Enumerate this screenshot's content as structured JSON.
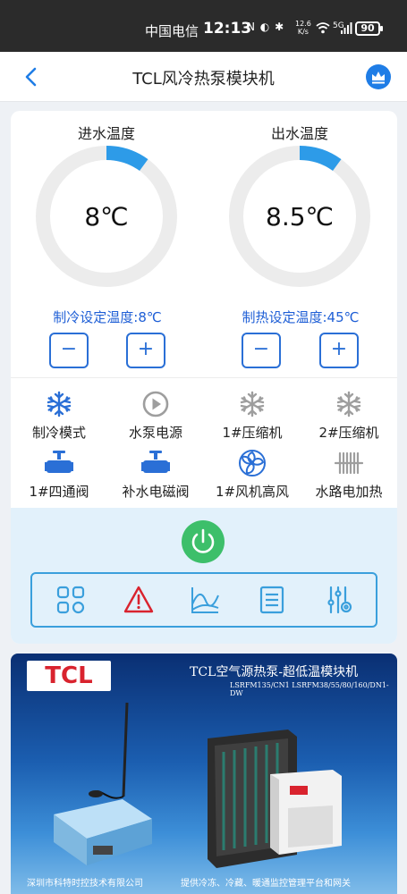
{
  "status_bar": {
    "carrier": "中国电信",
    "time": "12:13",
    "icons": "N ◐ ✱",
    "speed_value": "12.6",
    "speed_unit": "K/s",
    "network": "5G",
    "battery": "90"
  },
  "header": {
    "title": "TCL风冷热泵模块机",
    "back_icon": "chevron-left-icon",
    "crown_icon": "crown-icon"
  },
  "gauges": [
    {
      "label": "进水温度",
      "value": "8℃",
      "level": 0.1
    },
    {
      "label": "出水温度",
      "value": "8.5℃",
      "level": 0.1
    }
  ],
  "setpoints": {
    "cooling": "制冷设定温度:8℃",
    "heating": "制热设定温度:45℃",
    "minus": "−",
    "plus": "+"
  },
  "status_items": [
    {
      "label": "制冷模式",
      "icon": "snowflake-icon",
      "color": "#2a6fd6"
    },
    {
      "label": "水泵电源",
      "icon": "play-icon",
      "color": "#9e9e9e"
    },
    {
      "label": "1#压缩机",
      "icon": "snowflake-icon",
      "color": "#9e9e9e"
    },
    {
      "label": "2#压缩机",
      "icon": "snowflake-icon",
      "color": "#9e9e9e"
    },
    {
      "label": "1#四通阀",
      "icon": "valve-icon",
      "color": "#2a6fd6"
    },
    {
      "label": "补水电磁阀",
      "icon": "valve-icon",
      "color": "#2a6fd6"
    },
    {
      "label": "1#风机高风",
      "icon": "fan-icon",
      "color": "#2a6fd6"
    },
    {
      "label": "水路电加热",
      "icon": "heater-icon",
      "color": "#9e9e9e"
    }
  ],
  "toolbar": {
    "items": [
      "grid-icon",
      "alarm-icon",
      "trend-chart-icon",
      "list-icon",
      "settings-sliders-icon"
    ]
  },
  "colors": {
    "accent": "#1f7de6",
    "gauge_arc": "#2d9be8",
    "power": "#3dbf6a",
    "alarm": "#d9232e"
  },
  "banner": {
    "logo": "TCL",
    "title": "TCL空气源热泵-超低温模块机",
    "subtitle": "LSRFM135/CN1  LSRFM38/55/80/160/DN1-DW",
    "footer_left": "深圳市科特时控技术有限公司",
    "footer_right": "提供冷冻、冷藏、暖通监控管理平台和网关"
  }
}
